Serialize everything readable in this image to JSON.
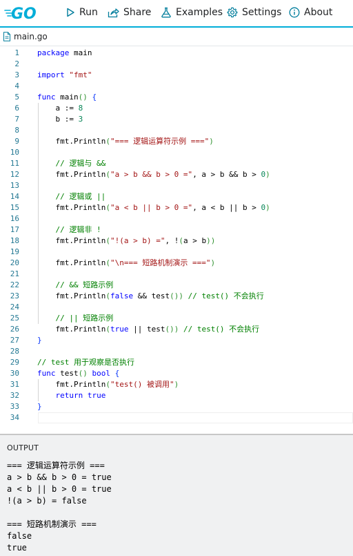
{
  "nav": {
    "logo": "GO",
    "run": "Run",
    "share": "Share",
    "examples": "Examples",
    "settings": "Settings",
    "about": "About",
    "accent": "#00add8"
  },
  "tab": {
    "filename": "main.go"
  },
  "editor": {
    "lines": [
      "package main",
      "",
      "import \"fmt\"",
      "",
      "func main() {",
      "    a := 8",
      "    b := 3",
      "",
      "    fmt.Println(\"=== 逻辑运算符示例 ===\")",
      "",
      "    // 逻辑与 &&",
      "    fmt.Println(\"a > b && b > 0 =\", a > b && b > 0)",
      "",
      "    // 逻辑或 ||",
      "    fmt.Println(\"a < b || b > 0 =\", a < b || b > 0)",
      "",
      "    // 逻辑非 !",
      "    fmt.Println(\"!(a > b) =\", !(a > b))",
      "",
      "    fmt.Println(\"\\n=== 短路机制演示 ===\")",
      "",
      "    // && 短路示例",
      "    fmt.Println(false && test()) // test() 不会执行",
      "",
      "    // || 短路示例",
      "    fmt.Println(true || test()) // test() 不会执行",
      "}",
      "",
      "// test 用于观察是否执行",
      "func test() bool {",
      "    fmt.Println(\"test() 被调用\")",
      "    return true",
      "}",
      ""
    ]
  },
  "output": {
    "label": "OUTPUT",
    "text": "=== 逻辑运算符示例 ===\na > b && b > 0 = true\na < b || b > 0 = true\n!(a > b) = false\n\n=== 短路机制演示 ===\nfalse\ntrue"
  }
}
